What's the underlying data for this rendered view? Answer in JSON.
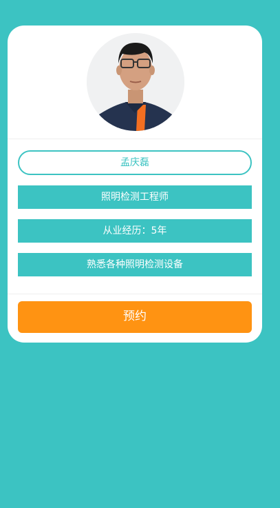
{
  "profile": {
    "name": "孟庆磊",
    "title": "照明检测工程师",
    "experience": "从业经历：5年",
    "skill": "熟悉各种照明检测设备"
  },
  "actions": {
    "book_label": "预约"
  },
  "colors": {
    "page_background": "#3cc3c2",
    "accent": "#3cc3c2",
    "button": "#ff9312",
    "card": "#ffffff"
  },
  "icons": {
    "avatar": "engineer-avatar"
  }
}
